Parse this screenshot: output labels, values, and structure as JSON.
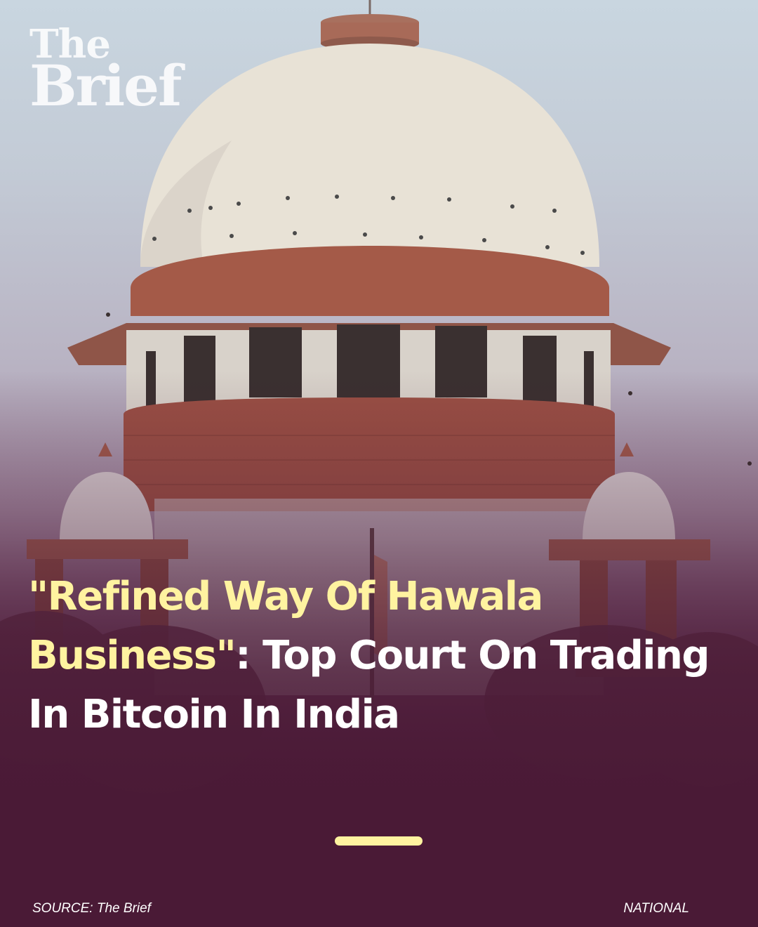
{
  "brand": {
    "logo_line1": "The",
    "logo_line2": "Brief"
  },
  "headline": {
    "highlight": "\"Refined Way Of Hawala Business\"",
    "rest": ": Top Court On Trading In Bitcoin In India"
  },
  "footer": {
    "source": "SOURCE: The Brief",
    "category": "NATIONAL"
  },
  "colors": {
    "highlight": "#fff3a0",
    "background": "#4a1a36",
    "text": "#ffffff"
  }
}
